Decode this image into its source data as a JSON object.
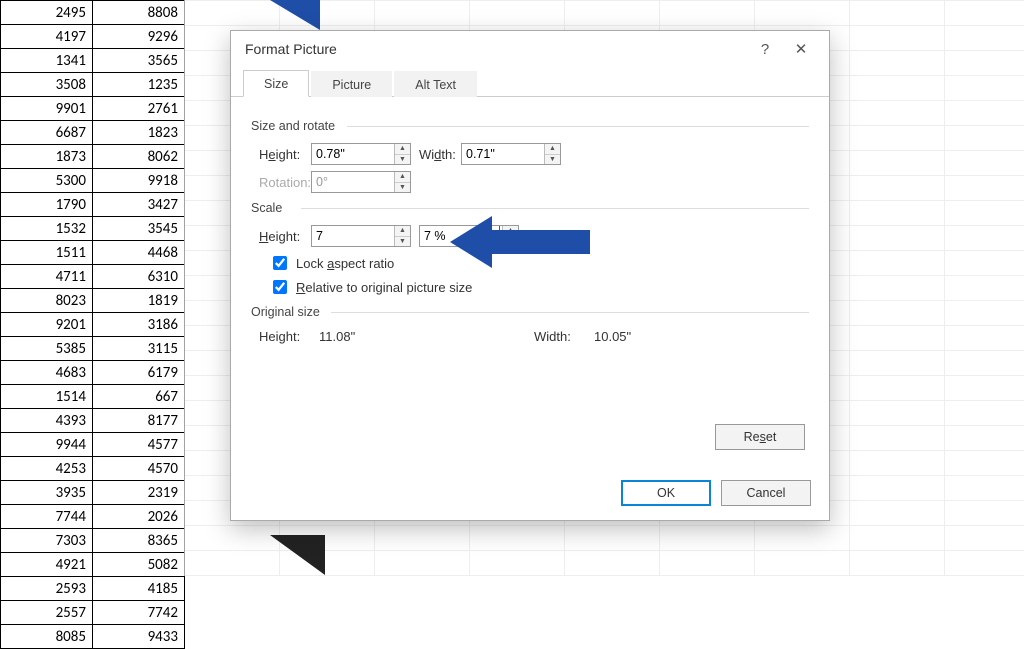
{
  "sheet": {
    "rows": [
      [
        2495,
        8808
      ],
      [
        4197,
        9296
      ],
      [
        1341,
        3565
      ],
      [
        3508,
        1235
      ],
      [
        9901,
        2761
      ],
      [
        6687,
        1823
      ],
      [
        1873,
        8062
      ],
      [
        5300,
        9918
      ],
      [
        1790,
        3427
      ],
      [
        1532,
        3545
      ],
      [
        1511,
        4468
      ],
      [
        4711,
        6310
      ],
      [
        8023,
        1819
      ],
      [
        9201,
        3186
      ],
      [
        5385,
        3115
      ],
      [
        4683,
        6179
      ],
      [
        1514,
        667
      ],
      [
        4393,
        8177
      ],
      [
        9944,
        4577
      ],
      [
        4253,
        4570
      ],
      [
        3935,
        2319
      ],
      [
        7744,
        2026
      ],
      [
        7303,
        8365
      ],
      [
        4921,
        5082
      ],
      [
        2593,
        4185
      ],
      [
        2557,
        7742
      ],
      [
        8085,
        9433
      ]
    ]
  },
  "dialog": {
    "title": "Format Picture",
    "tabs": {
      "size": "Size",
      "picture": "Picture",
      "alttext": "Alt Text"
    },
    "groups": {
      "size_rotate": "Size and rotate",
      "scale": "Scale",
      "original": "Original size"
    },
    "labels": {
      "height": "Height:",
      "width": "Width:",
      "rotation": "Rotation:",
      "lock": "Lock aspect ratio",
      "relative": "Relative to original picture size"
    },
    "values": {
      "height": "0.78\"",
      "width": "0.71\"",
      "rotation": "0°",
      "scale_height": "7",
      "scale_width": "7 %",
      "orig_height": "11.08\"",
      "orig_width": "10.05\""
    },
    "buttons": {
      "reset": "Reset",
      "ok": "OK",
      "cancel": "Cancel"
    }
  }
}
